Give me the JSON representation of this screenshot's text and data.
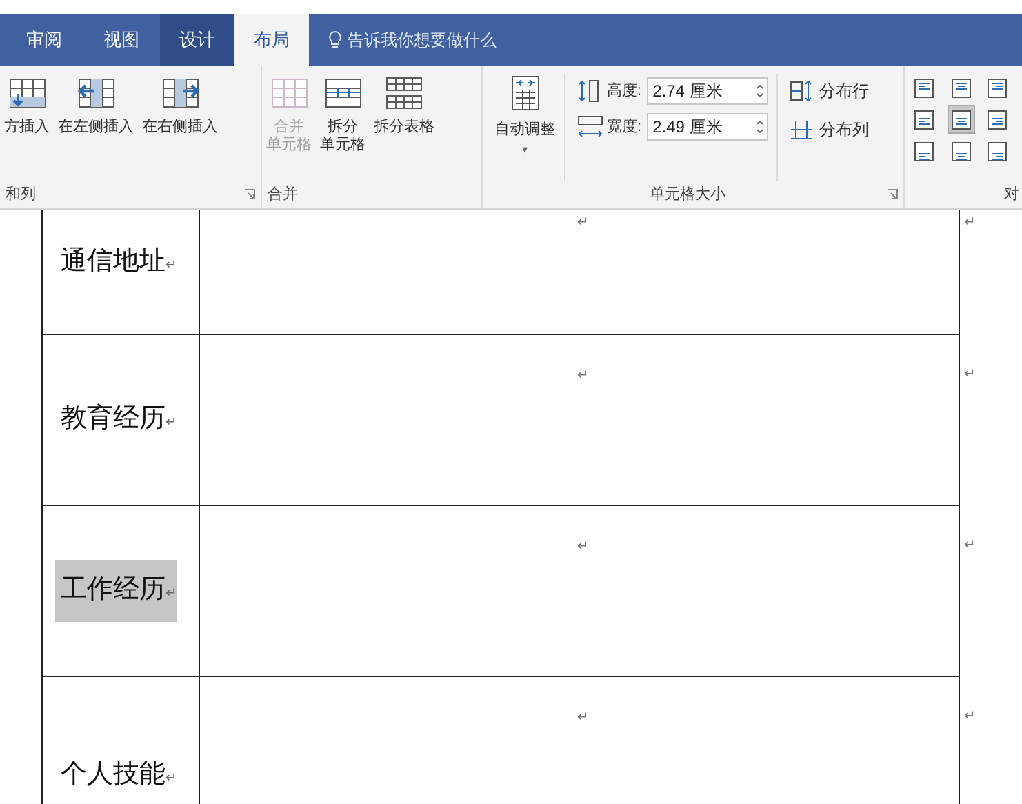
{
  "tabs": [
    {
      "label": "审阅",
      "selected": false,
      "contextual": false
    },
    {
      "label": "视图",
      "selected": false,
      "contextual": false
    },
    {
      "label": "设计",
      "selected": false,
      "contextual": true
    },
    {
      "label": "布局",
      "selected": true,
      "contextual": true
    }
  ],
  "tell_me": {
    "placeholder": "告诉我你想要做什么"
  },
  "ribbon": {
    "groups": [
      {
        "label": "和列",
        "launcher": true,
        "buttons": [
          {
            "kind": "insert-below",
            "lines": [
              "方插入"
            ],
            "disabled": false
          },
          {
            "kind": "insert-left",
            "lines": [
              "在左侧插入"
            ],
            "disabled": false
          },
          {
            "kind": "insert-right",
            "lines": [
              "在右侧插入"
            ],
            "disabled": false
          }
        ]
      },
      {
        "label": "合并",
        "launcher": false,
        "buttons": [
          {
            "kind": "merge",
            "lines": [
              "合并",
              "单元格"
            ],
            "disabled": true
          },
          {
            "kind": "split-cells",
            "lines": [
              "拆分",
              "单元格"
            ],
            "disabled": false
          },
          {
            "kind": "split-table",
            "lines": [
              "拆分表格"
            ],
            "disabled": false
          }
        ]
      },
      {
        "label": "单元格大小",
        "launcher": true,
        "autofit": {
          "label": "自动调整",
          "caret": "▾"
        },
        "height": {
          "label": "高度:",
          "value": "2.74 厘米"
        },
        "width": {
          "label": "宽度:",
          "value": "2.49 厘米"
        },
        "distribute": [
          {
            "kind": "rows",
            "label": "分布行"
          },
          {
            "kind": "columns",
            "label": "分布列"
          }
        ]
      },
      {
        "label": "对",
        "launcher": false,
        "align": [
          {
            "selected": false
          },
          {
            "selected": false
          },
          {
            "selected": false
          },
          {
            "selected": false
          },
          {
            "selected": true
          },
          {
            "selected": false
          },
          {
            "selected": false
          },
          {
            "selected": false
          },
          {
            "selected": false
          }
        ]
      }
    ]
  },
  "table": {
    "rows": [
      {
        "label": "通信地址",
        "label_mark": "↵",
        "cell_mark": "↵",
        "row_mark": "↵",
        "selected": false
      },
      {
        "label": "教育经历",
        "label_mark": "↵",
        "cell_mark": "↵",
        "row_mark": "↵",
        "selected": false
      },
      {
        "label": "工作经历",
        "label_mark": "↵",
        "cell_mark": "↵",
        "row_mark": "↵",
        "selected": true
      },
      {
        "label": "个人技能",
        "label_mark": "↵",
        "cell_mark": "↵",
        "row_mark": "↵",
        "selected": false
      }
    ]
  }
}
